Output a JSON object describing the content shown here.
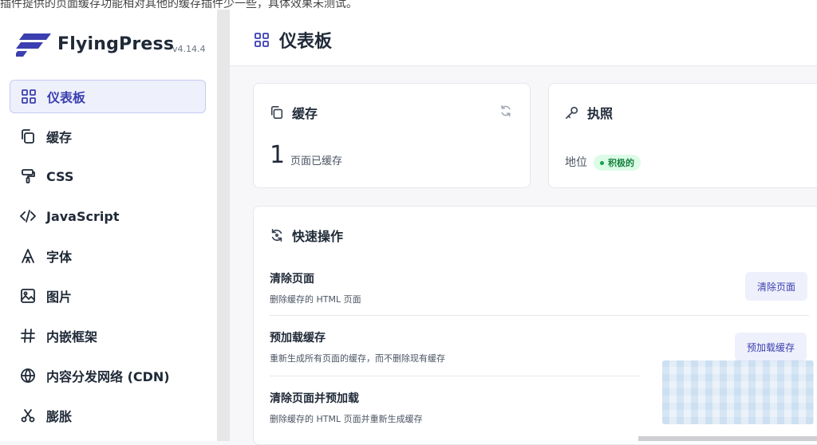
{
  "top_note": "插件提供的页面缓存功能相对其他的缓存插件少一些，具体效果未测试。",
  "brand": {
    "name": "FlyingPress",
    "version": "v4.14.4",
    "accent": "#3b3fb0"
  },
  "sidebar": {
    "items": [
      {
        "label": "仪表板",
        "icon": "dashboard-grid-icon",
        "active": true
      },
      {
        "label": "缓存",
        "icon": "copy-icon",
        "active": false
      },
      {
        "label": "CSS",
        "icon": "paint-roller-icon",
        "active": false
      },
      {
        "label": "JavaScript",
        "icon": "code-icon",
        "active": false
      },
      {
        "label": "字体",
        "icon": "font-icon",
        "active": false
      },
      {
        "label": "图片",
        "icon": "image-icon",
        "active": false
      },
      {
        "label": "内嵌框架",
        "icon": "hash-icon",
        "active": false
      },
      {
        "label": "内容分发网络 (CDN)",
        "icon": "globe-icon",
        "active": false
      },
      {
        "label": "膨胀",
        "icon": "scissors-icon",
        "active": false
      }
    ]
  },
  "page": {
    "title": "仪表板",
    "title_icon": "dashboard-grid-icon"
  },
  "cache_card": {
    "title": "缓存",
    "count": "1",
    "count_label": "页面已缓存",
    "icon": "copy-icon",
    "refresh_icon": "refresh-icon"
  },
  "license_card": {
    "title": "执照",
    "status_label": "地位",
    "status_value": "积极的",
    "icon": "key-icon",
    "status_color": "#16a34a"
  },
  "quick_actions": {
    "title": "快速操作",
    "icon": "refresh-icon",
    "actions": [
      {
        "title": "清除页面",
        "desc": "删除缓存的 HTML 页面",
        "button": "清除页面"
      },
      {
        "title": "预加载缓存",
        "desc": "重新生成所有页面的缓存，而不删除现有缓存",
        "button": "预加载缓存"
      },
      {
        "title": "清除页面并预加载",
        "desc": "删除缓存的 HTML 页面并重新生成缓存",
        "button": ""
      }
    ]
  }
}
